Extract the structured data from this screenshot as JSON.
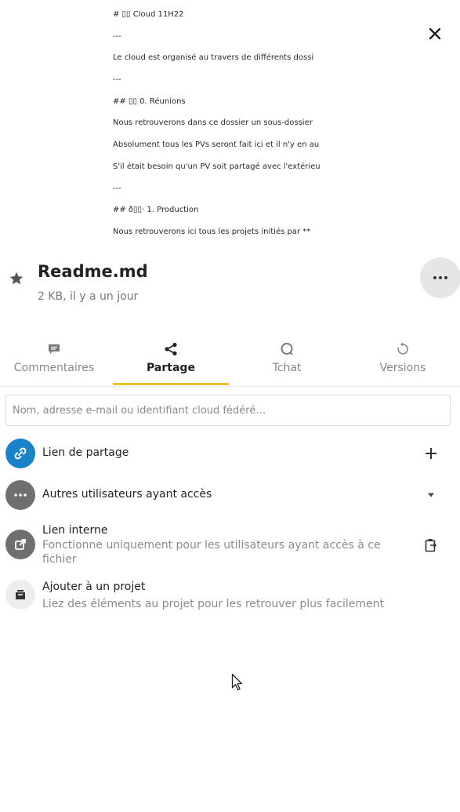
{
  "preview": {
    "lines": [
      "# ▯▯ Cloud 11H22",
      "---",
      "Le cloud est organisé au travers de différents dossi",
      "---",
      "## ▯▯ 0. Réunions",
      "Nous retrouverons dans ce dossier un sous-dossier",
      "Absolument tous les PVs seront fait ici et il n'y en au",
      "S'il était besoin qu'un PV soit partagé avec l'extérieu",
      "---",
      "## ð▯▯· 1. Production",
      "Nous retrouverons ici tous les projets initiés par **"
    ]
  },
  "file": {
    "name": "Readme.md",
    "meta": "2 KB, il y a un jour"
  },
  "tabs": [
    {
      "label": "Commentaires",
      "icon": "comment-icon"
    },
    {
      "label": "Partage",
      "icon": "share-icon"
    },
    {
      "label": "Tchat",
      "icon": "chat-icon"
    },
    {
      "label": "Versions",
      "icon": "history-icon"
    }
  ],
  "active_tab": "Partage",
  "search": {
    "placeholder": "Nom, adresse e-mail ou identifiant cloud fédéré…"
  },
  "sharing": {
    "share_link": {
      "title": "Lien de partage",
      "icon": "link-icon",
      "action_icon": "plus-icon"
    },
    "other_users": {
      "title": "Autres utilisateurs ayant accès",
      "icon": "more-horizontal-icon",
      "action_icon": "triangle-down-icon"
    },
    "internal_link": {
      "title": "Lien interne",
      "subtitle": "Fonctionne uniquement pour les utilisateurs ayant accès à ce fichier",
      "icon": "external-link-icon",
      "action_icon": "clipboard-icon"
    },
    "add_project": {
      "title": "Ajouter à un projet",
      "subtitle": "Liez des éléments au projet pour les retrouver plus facilement",
      "icon": "projects-icon"
    }
  },
  "colors": {
    "accent_blue": "#1a82c8",
    "avatar_gray": "#6f6f6f",
    "tab_underline": "#e9c22c",
    "more_button_bg": "#e6e6e6"
  }
}
